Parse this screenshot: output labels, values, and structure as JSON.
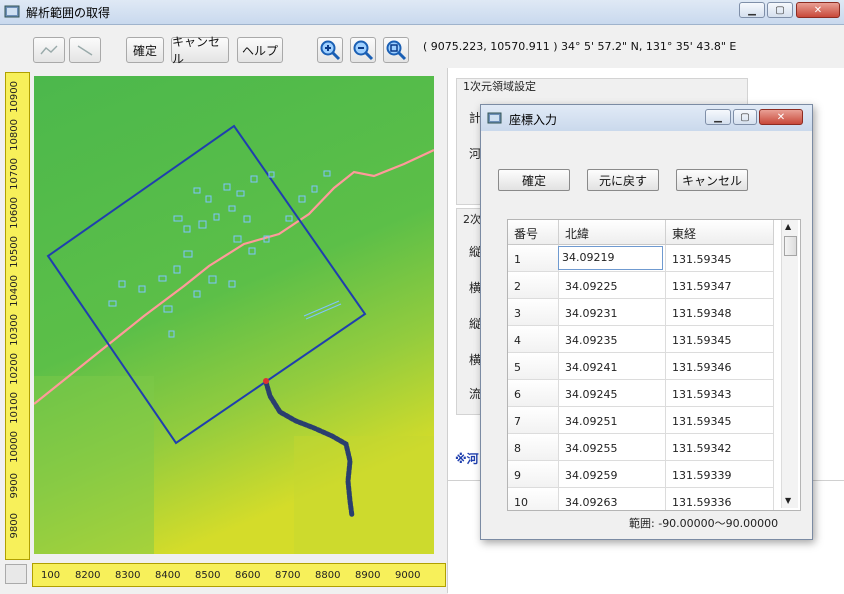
{
  "window": {
    "title": "解析範囲の取得"
  },
  "toolbar": {
    "confirm": "確定",
    "cancel": "キャンセル",
    "help": "ヘルプ",
    "coords": "( 9075.223, 10570.911 ) 34° 5' 57.2\" N, 131° 35' 43.8\" E"
  },
  "rulers": {
    "vertical": [
      "10900",
      "10800",
      "10700",
      "10600",
      "10500",
      "10400",
      "10300",
      "10200",
      "10100",
      "10000",
      "9900",
      "9800"
    ],
    "horizontal": [
      "100",
      "8200",
      "8300",
      "8400",
      "8500",
      "8600",
      "8700",
      "8800",
      "8900",
      "9000"
    ]
  },
  "panel": {
    "section1": "1次元領域設定",
    "s1_row1": "計",
    "s1_row2": "河",
    "section2": "2次",
    "s2_rows": [
      "縦",
      "横",
      "縦",
      "横",
      "流"
    ],
    "note": "※河"
  },
  "dialog": {
    "title": "座標入力",
    "confirm": "確定",
    "revert": "元に戻す",
    "cancel": "キャンセル",
    "headers": [
      "番号",
      "北緯",
      "東経"
    ],
    "rows": [
      [
        "1",
        "34.09219",
        "131.59345"
      ],
      [
        "2",
        "34.09225",
        "131.59347"
      ],
      [
        "3",
        "34.09231",
        "131.59348"
      ],
      [
        "4",
        "34.09235",
        "131.59345"
      ],
      [
        "5",
        "34.09241",
        "131.59346"
      ],
      [
        "6",
        "34.09245",
        "131.59343"
      ],
      [
        "7",
        "34.09251",
        "131.59345"
      ],
      [
        "8",
        "34.09255",
        "131.59342"
      ],
      [
        "9",
        "34.09259",
        "131.59339"
      ],
      [
        "10",
        "34.09263",
        "131.59336"
      ]
    ],
    "range_label": "範囲:",
    "range_value": "-90.00000〜90.00000"
  },
  "colors": {
    "boundary": "#1f3fae",
    "road": "#ff9a9a",
    "stream": "#2a3f6e",
    "ruler": "#f7f05a"
  }
}
